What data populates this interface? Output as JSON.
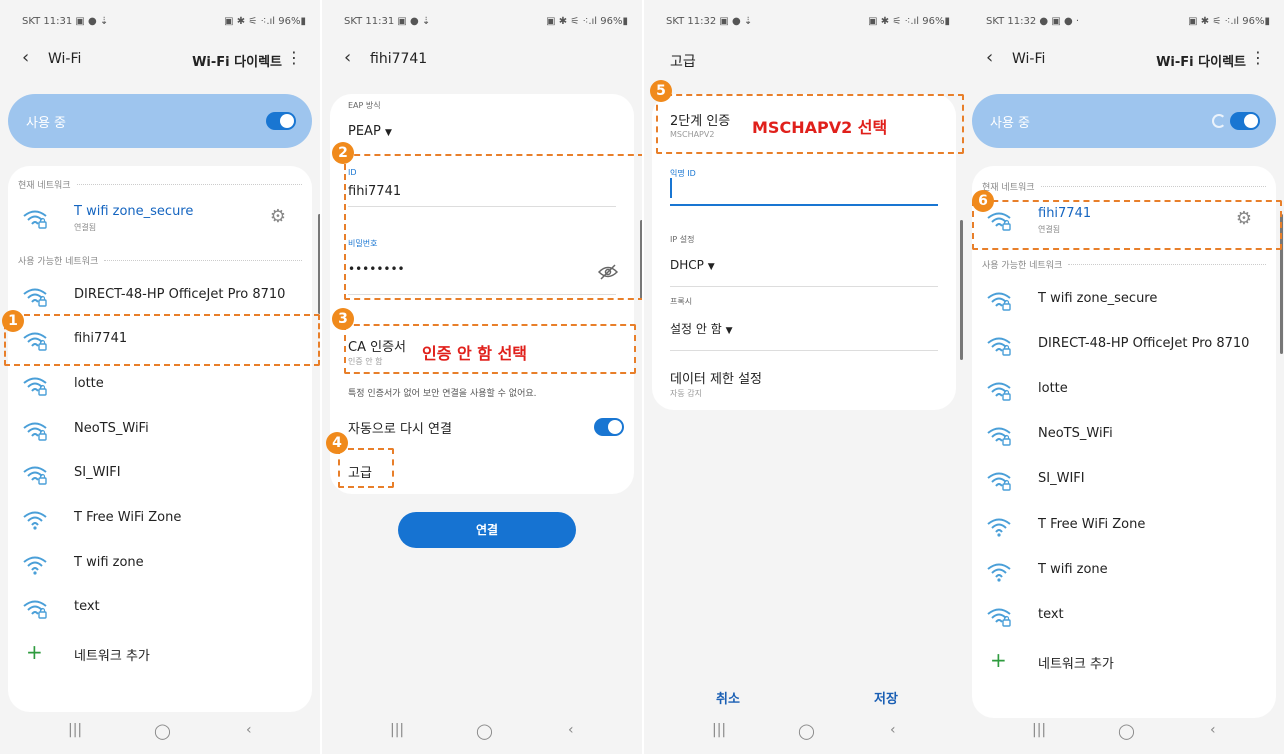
{
  "status_bars": [
    "SKT 11:31 ▣ ● ⇣",
    "SKT 11:31 ▣ ● ⇣",
    "SKT 11:32 ▣ ● ⇣",
    "SKT 11:32 ● ▣ ● ·"
  ],
  "status_right": "▣ ✱ ⚟ ⁖.ıl 96%▮",
  "wifi_list": {
    "back_title": "Wi-Fi",
    "direct_label": "Wi-Fi 다이렉트",
    "on_label": "사용 중",
    "current_header": "현재 네트워크",
    "available_header": "사용 가능한 네트워크",
    "current_network": {
      "name": "T wifi zone_secure",
      "status": "연결됨"
    },
    "networks": [
      "DIRECT-48-HP OfficeJet Pro 8710",
      "fihi7741",
      "lotte",
      "NeoTS_WiFi",
      "SI_WIFI",
      "T Free WiFi Zone",
      "T wifi zone",
      "text"
    ],
    "add_network": "네트워크 추가"
  },
  "connect_form": {
    "back_title": "fihi7741",
    "eap_label": "EAP 방식",
    "eap_value": "PEAP",
    "id_label": "ID",
    "id_value": "fihi7741",
    "password_label": "비밀번호",
    "password_value": "••••••••",
    "ca_label": "CA 인증서",
    "ca_value": "인증 안 함",
    "ca_warning": "특정 인증서가 없어 보안 연결을 사용할 수 없어요.",
    "auto_reconnect": "자동으로 다시 연결",
    "advanced": "고급",
    "connect_button": "연결"
  },
  "advanced_screen": {
    "title": "고급",
    "phase2_label": "2단계 인증",
    "phase2_value": "MSCHAPV2",
    "anon_id_label": "익명 ID",
    "ip_label": "IP 설정",
    "ip_value": "DHCP",
    "proxy_label": "프록시",
    "proxy_value": "설정 안 함",
    "metered_label": "데이터 제한 설정",
    "metered_value": "자동 감지",
    "cancel": "취소",
    "save": "저장"
  },
  "connected_list": {
    "current_network": {
      "name": "fihi7741",
      "status": "연결됨"
    },
    "networks": [
      "T wifi zone_secure",
      "DIRECT-48-HP OfficeJet Pro 8710",
      "lotte",
      "NeoTS_WiFi",
      "SI_WIFI",
      "T Free WiFi Zone",
      "T wifi zone",
      "text"
    ]
  },
  "annotations": {
    "steps": [
      "1",
      "2",
      "3",
      "4",
      "5",
      "6"
    ],
    "ca_note": "인증 안 함 선택",
    "phase2_note": "MSCHAPV2 선택"
  },
  "nav": {
    "recent": "|||",
    "home": "◯",
    "back": "‹"
  },
  "colors": {
    "accent": "#1976d2",
    "highlight": "#e87f2a",
    "badge": "#f08a1c",
    "annotation": "#e0201b",
    "wifi_icon": "#4a9fd8"
  },
  "icons": {
    "wifi": "wifi-icon",
    "gear": "gear-icon",
    "eye_off": "eye-off-icon",
    "plus": "plus-icon"
  }
}
